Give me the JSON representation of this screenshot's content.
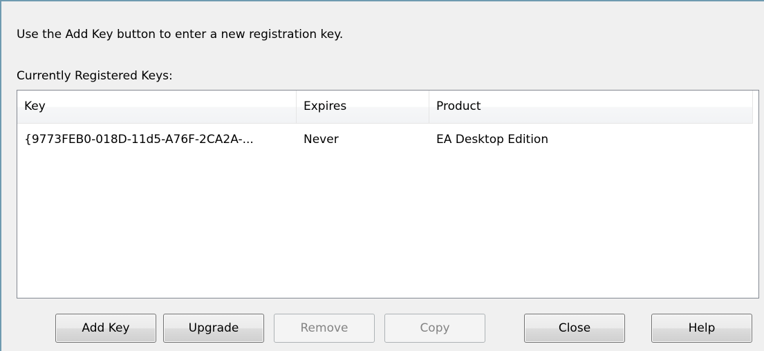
{
  "dialog": {
    "instruction": "Use the Add Key button to enter a new registration key.",
    "section_label": "Currently Registered Keys:"
  },
  "list": {
    "columns": {
      "key": "Key",
      "expires": "Expires",
      "product": "Product"
    },
    "rows": [
      {
        "key": "{9773FEB0-018D-11d5-A76F-2CA2A-...",
        "expires": "Never",
        "product": "EA Desktop Edition"
      }
    ]
  },
  "buttons": {
    "add_key": "Add Key",
    "upgrade": "Upgrade",
    "remove": "Remove",
    "copy": "Copy",
    "close": "Close",
    "help": "Help"
  },
  "colors": {
    "window_background": "#f0f0f0",
    "list_background": "#ffffff",
    "disabled_text": "#838383"
  }
}
